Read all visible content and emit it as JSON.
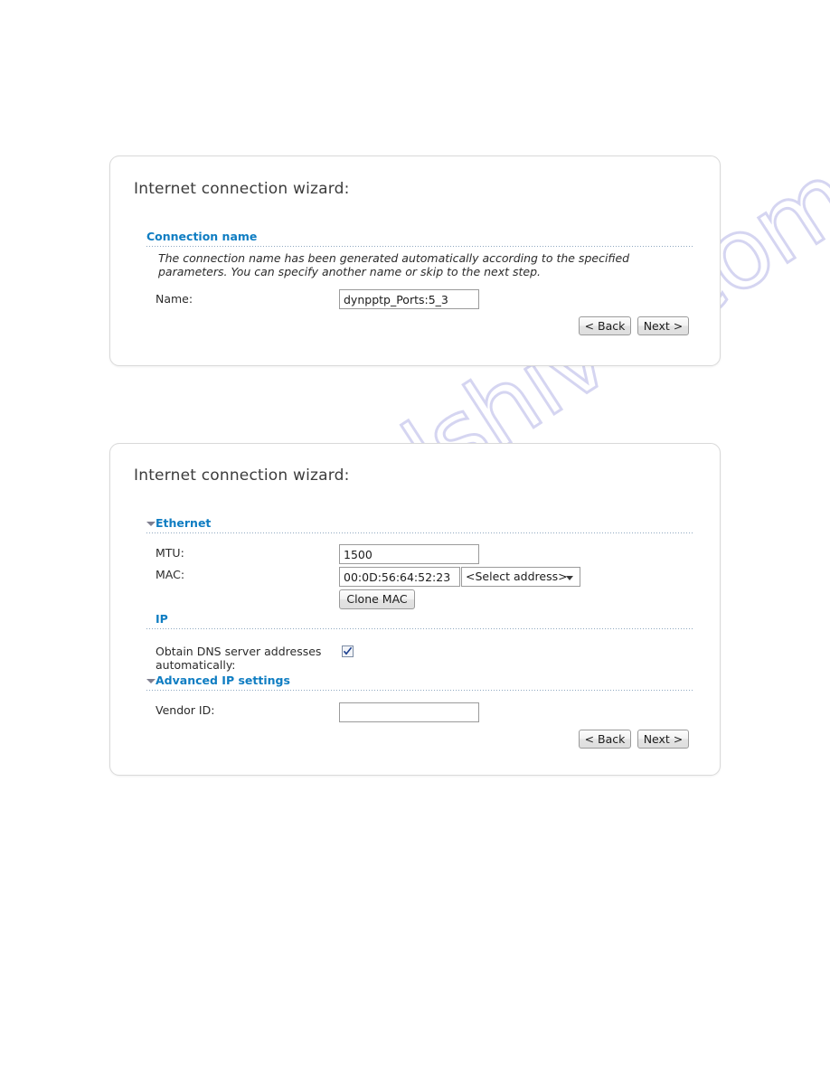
{
  "watermark": {
    "text": "manualshive.com"
  },
  "colors": {
    "heading_blue": "#0f7dc2",
    "panel_border": "#d9d9d9",
    "dotted_rule": "#8fa8c0",
    "text": "#2b2b2b"
  },
  "panels": [
    {
      "title": "Internet connection wizard:",
      "sections": [
        {
          "label": "Connection name",
          "collapsible": false,
          "description": "The connection name has been generated automatically according to the specified parameters. You can specify another name or skip to the next step.",
          "fields": [
            {
              "label": "Name:",
              "type": "text",
              "value": "dynpptp_Ports:5_3"
            }
          ]
        }
      ],
      "buttons": [
        {
          "label": "< Back",
          "name": "back-button"
        },
        {
          "label": "Next >",
          "name": "next-button"
        }
      ]
    },
    {
      "title": "Internet connection wizard:",
      "sections": [
        {
          "label": "Ethernet",
          "collapsible": true,
          "fields": [
            {
              "label": "MTU:",
              "type": "text",
              "value": "1500"
            },
            {
              "label": "MAC:",
              "type": "text",
              "value": "00:0D:56:64:52:23"
            }
          ],
          "select": {
            "value": "<Select address>",
            "name": "select-address-dropdown"
          },
          "button": {
            "label": "Clone MAC",
            "name": "clone-mac-button"
          }
        },
        {
          "label": "IP",
          "collapsible": false,
          "checkbox": {
            "label_line1": "Obtain DNS server addresses",
            "label_line2": "automatically:",
            "checked": true
          }
        },
        {
          "label": "Advanced IP settings",
          "collapsible": true,
          "fields": [
            {
              "label": "Vendor ID:",
              "type": "text",
              "value": ""
            }
          ]
        }
      ],
      "buttons": [
        {
          "label": "< Back",
          "name": "back-button"
        },
        {
          "label": "Next >",
          "name": "next-button"
        }
      ]
    }
  ]
}
